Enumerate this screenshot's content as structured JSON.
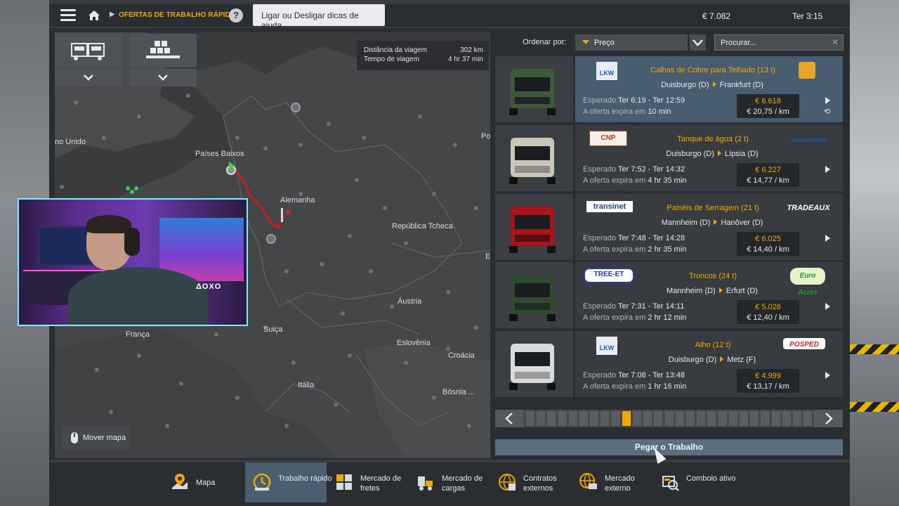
{
  "topbar": {
    "breadcrumb": "OFERTAS DE TRABALHO RÁPIDO",
    "help_tooltip": "Ligar ou Desligar dicas de ajuda",
    "money": "€ 7.082",
    "time": "Ter 3:15"
  },
  "map": {
    "trip_distance_label": "Distância da viagem",
    "trip_distance_value": "302 km",
    "trip_time_label": "Tempo de viagem",
    "trip_time_value": "4 hr 37 min",
    "labels": {
      "uk": "no Unido",
      "netherlands": "Países Baixos",
      "germany": "Alemanha",
      "czech": "República Tcheca",
      "austria": "Áustria",
      "switzerland": "Suiça",
      "france": "França",
      "slovenia": "Eslovênia",
      "croatia": "Croácia",
      "italy": "Itália",
      "bosnia": "Bósnia ...",
      "po": "Po",
      "e": "E"
    },
    "move_map": "Mover mapa"
  },
  "sort": {
    "label": "Ordenar por:",
    "value": "Preço",
    "search_placeholder": "Procurar..."
  },
  "jobs": [
    {
      "company_left": "LKW",
      "cargo": "Calhas de Cobre para Telhado (13 t)",
      "company_right": "",
      "from": "Duisburgo (D)",
      "to": "Frankfurt (D)",
      "expected_label": "Esperado",
      "expected": "Ter 6:19 - Ter 12:59",
      "expire_label": "A oferta expira em",
      "expire": "10 min",
      "price": "€ 6.618",
      "per_km": "€ 20,75 / km",
      "truck_color": "#3c5a3a"
    },
    {
      "company_left": "CNP",
      "cargo": "Tanque de água (2 t)",
      "company_right": "SANBUILDERS",
      "from": "Duisburgo (D)",
      "to": "Lípsia (D)",
      "expected_label": "Esperado",
      "expected": "Ter 7:52 - Ter 14:32",
      "expire_label": "A oferta expira em",
      "expire": "4 hr 35 min",
      "price": "€ 6.227",
      "per_km": "€ 14,77 / km",
      "truck_color": "#c9c6b8"
    },
    {
      "company_left": "transinet",
      "cargo": "Painéis de Serragem (21 t)",
      "company_right": "TRADEAUX",
      "from": "Mannheim (D)",
      "to": "Hanôver (D)",
      "expected_label": "Esperado",
      "expected": "Ter 7:48 - Ter 14:28",
      "expire_label": "A oferta expira em",
      "expire": "2 hr 35 min",
      "price": "€ 6.025",
      "per_km": "€ 14,40 / km",
      "truck_color": "#a4161b"
    },
    {
      "company_left": "TREE-ET",
      "cargo": "Troncos (24 t)",
      "company_right": "Euro Acres",
      "from": "Mannheim (D)",
      "to": "Erfurt (D)",
      "expected_label": "Esperado",
      "expected": "Ter 7:31 - Ter 14:11",
      "expire_label": "A oferta expira em",
      "expire": "2 hr 12 min",
      "price": "€ 5.026",
      "per_km": "€ 12,40 / km",
      "truck_color": "#2f4a30"
    },
    {
      "company_left": "LKW",
      "cargo": "Alho (12 t)",
      "company_right": "POSPED",
      "from": "Duisburgo (D)",
      "to": "Metz (F)",
      "expected_label": "Esperado",
      "expected": "Ter 7:08 - Ter 13:48",
      "expire_label": "A oferta expira em",
      "expire": "1 hr 16 min",
      "price": "€ 4.999",
      "per_km": "€ 13,17 / km",
      "truck_color": "#d9dadb"
    }
  ],
  "pager": {
    "total_pages": 28,
    "current_page": 10
  },
  "take_job": "Pegar o Trabalho",
  "nav": [
    {
      "label": "Mapa",
      "icon": "map-icon"
    },
    {
      "label": "Trabalho rápido",
      "icon": "clock-icon"
    },
    {
      "label": "Mercado de fretes",
      "icon": "boxes-icon"
    },
    {
      "label": "Mercado de cargas",
      "icon": "trailer-icon"
    },
    {
      "label": "Contratos externos",
      "icon": "globe-boxes-icon"
    },
    {
      "label": "Mercado externo",
      "icon": "globe-truck-icon"
    },
    {
      "label": "Comboio ativo",
      "icon": "convoy-icon"
    }
  ],
  "webcam_overlay": {
    "brand_text": "ΔOXO"
  }
}
